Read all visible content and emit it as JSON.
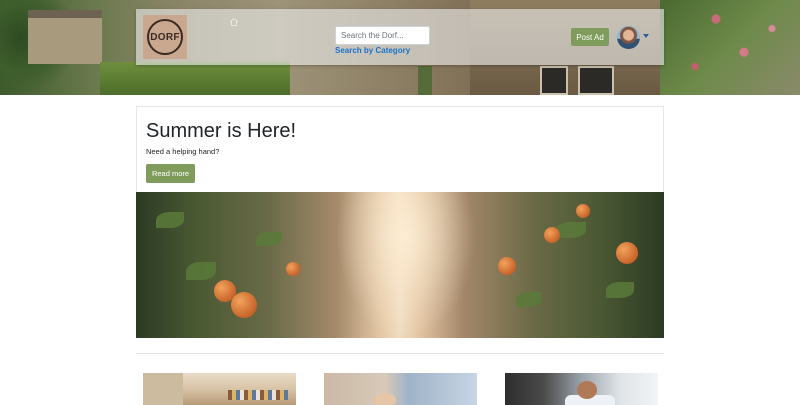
{
  "header": {
    "logo_text": "DORF",
    "search": {
      "placeholder": "Search the Dorf...",
      "value": ""
    },
    "category_link": "Search by Category",
    "post_ad_label": "Post Ad",
    "icons": [
      "home-icon",
      "avatar",
      "caret-down-icon"
    ]
  },
  "promo": {
    "title": "Summer is Here!",
    "subtitle": "Need a helping hand?",
    "button_label": "Read more"
  },
  "colors": {
    "accent_green": "#7f9c5c",
    "link_blue": "#1a73c9",
    "text_dark": "#212529",
    "logo_bg": "#c9a88f"
  }
}
